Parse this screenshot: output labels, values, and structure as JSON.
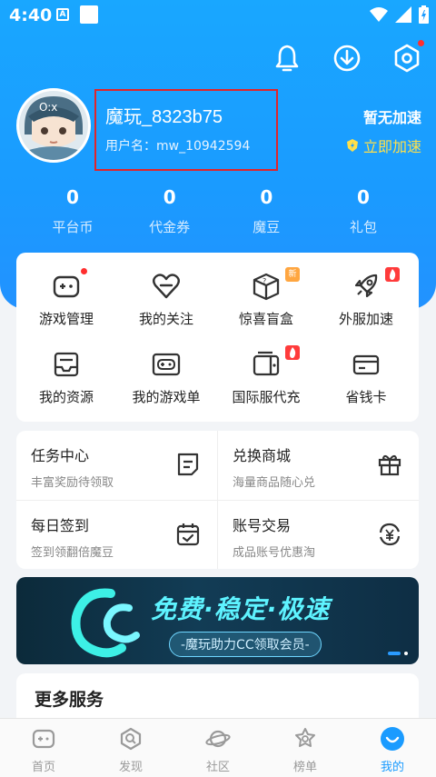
{
  "status_bar": {
    "time": "4:40",
    "a_label": "A"
  },
  "profile": {
    "nickname": "魔玩_8323b75",
    "username": "用户名：mw_10942594",
    "speed_status": "暂无加速",
    "speed_link": "立即加速"
  },
  "stats": [
    {
      "value": "0",
      "label": "平台币"
    },
    {
      "value": "0",
      "label": "代金券"
    },
    {
      "value": "0",
      "label": "魔豆"
    },
    {
      "value": "0",
      "label": "礼包"
    }
  ],
  "grid": [
    {
      "label": "游戏管理",
      "icon": "gamepad-icon"
    },
    {
      "label": "我的关注",
      "icon": "heart-icon"
    },
    {
      "label": "惊喜盲盒",
      "icon": "box-icon",
      "badge": "新"
    },
    {
      "label": "外服加速",
      "icon": "rocket-icon"
    },
    {
      "label": "我的资源",
      "icon": "inbox-icon"
    },
    {
      "label": "我的游戏单",
      "icon": "controller-icon"
    },
    {
      "label": "国际服代充",
      "icon": "wallet-icon"
    },
    {
      "label": "省钱卡",
      "icon": "card-icon"
    }
  ],
  "tasks": [
    {
      "title": "任务中心",
      "sub": "丰富奖励待领取",
      "icon": "note-icon"
    },
    {
      "title": "兑换商城",
      "sub": "海量商品随心兑",
      "icon": "gift-icon"
    },
    {
      "title": "每日签到",
      "sub": "签到领翻倍魔豆",
      "icon": "calendar-check-icon"
    },
    {
      "title": "账号交易",
      "sub": "成品账号优惠淘",
      "icon": "yen-exchange-icon"
    }
  ],
  "banner": {
    "title": "免费·稳定·极速",
    "sub": "-魔玩助力CC领取会员-",
    "logo": "CC"
  },
  "more": {
    "title": "更多服务"
  },
  "nav": [
    {
      "label": "首页",
      "icon": "home-gamepad-icon"
    },
    {
      "label": "发现",
      "icon": "discover-icon"
    },
    {
      "label": "社区",
      "icon": "planet-icon"
    },
    {
      "label": "榜单",
      "icon": "rank-icon"
    },
    {
      "label": "我的",
      "icon": "me-icon"
    }
  ],
  "colors": {
    "primary": "#1a9bff",
    "highlight_border": "#e0252b",
    "accent_yellow": "#ffe04a",
    "dot_red": "#ff2e2e"
  }
}
